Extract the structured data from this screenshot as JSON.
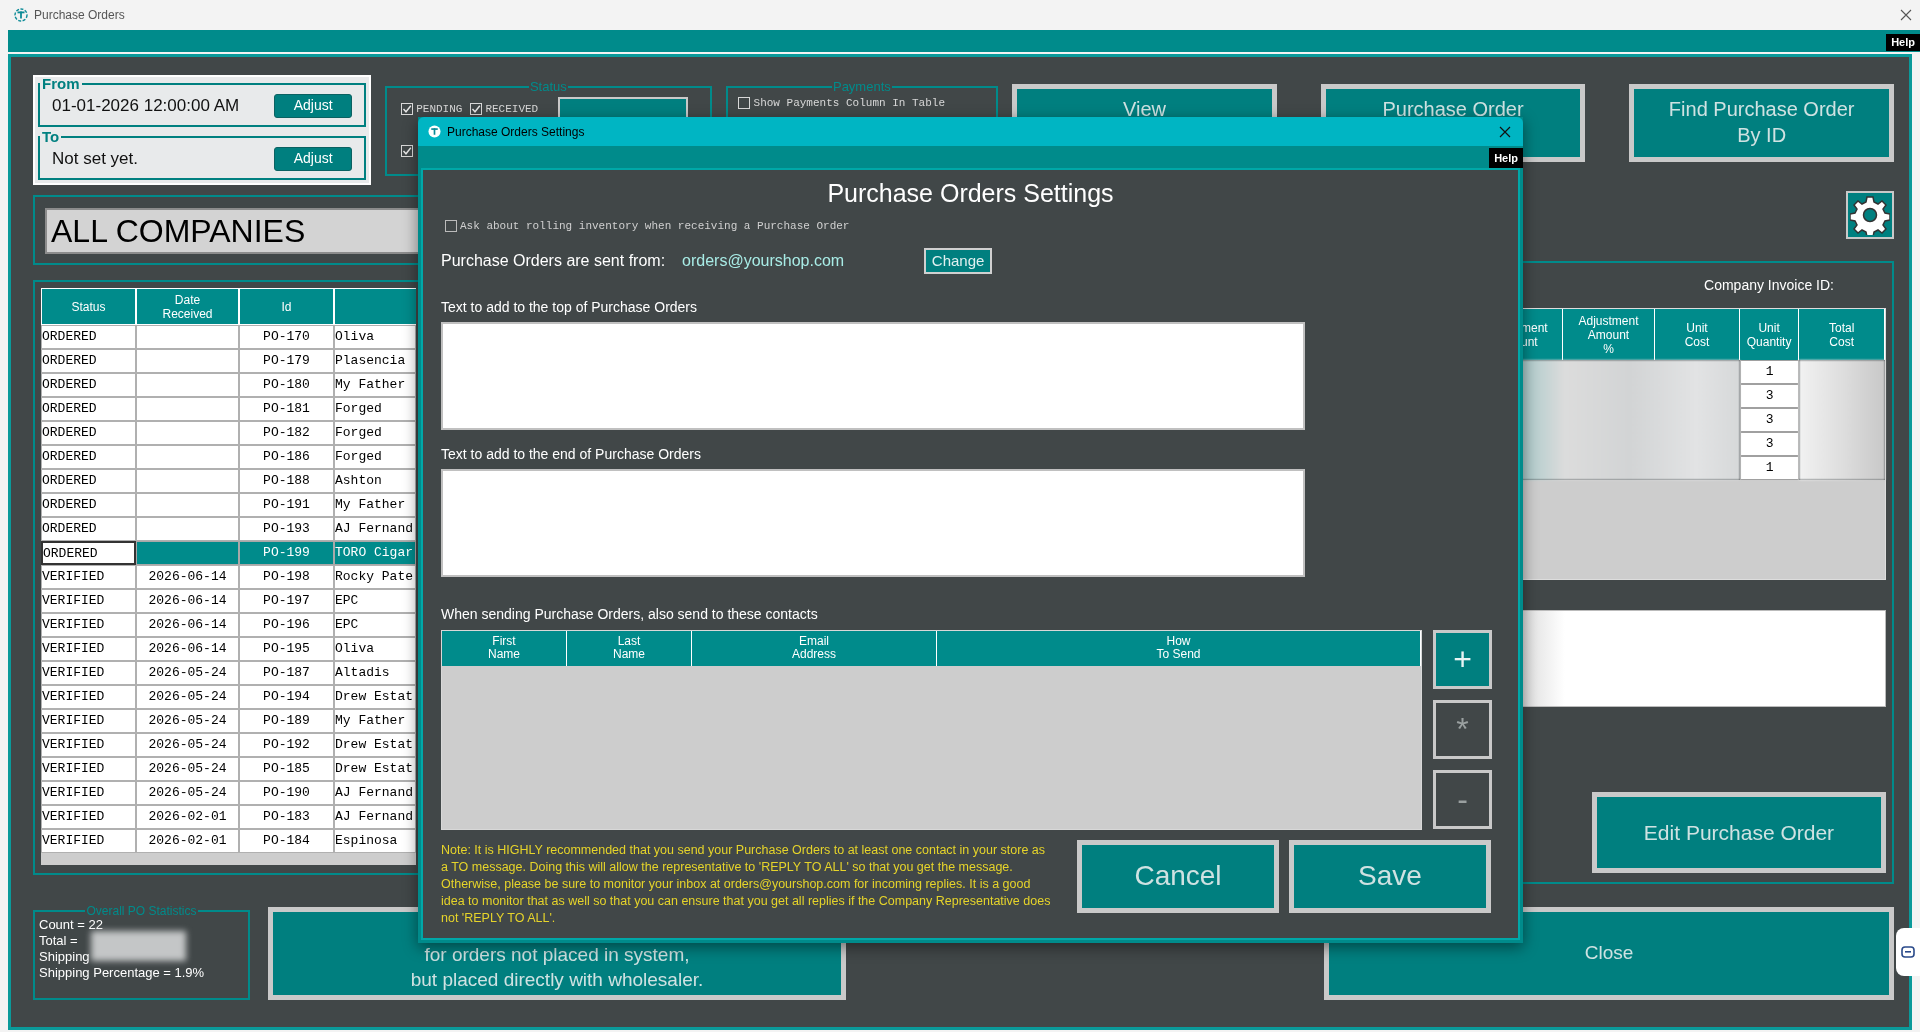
{
  "window": {
    "title": "Purchase Orders",
    "help": "Help"
  },
  "date_range": [
    {
      "label": "From",
      "value": "01-01-2026 12:00:00 AM",
      "button": "Adjust"
    },
    {
      "label": "To",
      "value": "Not set yet.",
      "button": "Adjust"
    }
  ],
  "status_filter": {
    "title": "Status",
    "options": [
      {
        "label": "PENDING",
        "checked": true
      },
      {
        "label": "RECEIVED",
        "checked": true
      },
      {
        "checked": true
      }
    ]
  },
  "payments": {
    "title": "Payments",
    "options": [
      {
        "label": "Show Payments Column In Table",
        "checked": false
      }
    ]
  },
  "top_buttons": [
    "View",
    "Purchase Order",
    "Find Purchase Order\nBy ID"
  ],
  "company_filter": {
    "value": "ALL COMPANIES"
  },
  "orders_table": {
    "columns": [
      "Status",
      "Date\nReceived",
      "Id"
    ],
    "rows": [
      {
        "status": "ORDERED",
        "id": "PO-170",
        "column_4": "Oliva",
        "selected": false
      },
      {
        "status": "ORDERED",
        "id": "PO-179",
        "column_4": "Plasencia",
        "selected": false
      },
      {
        "status": "ORDERED",
        "id": "PO-180",
        "column_4": "My Father",
        "selected": false
      },
      {
        "status": "ORDERED",
        "id": "PO-181",
        "column_4": "Forged",
        "selected": false
      },
      {
        "status": "ORDERED",
        "id": "PO-182",
        "column_4": "Forged",
        "selected": false
      },
      {
        "status": "ORDERED",
        "id": "PO-186",
        "column_4": "Forged",
        "selected": false
      },
      {
        "status": "ORDERED",
        "id": "PO-188",
        "column_4": "Ashton",
        "selected": false
      },
      {
        "status": "ORDERED",
        "id": "PO-191",
        "column_4": "My Father",
        "selected": false
      },
      {
        "status": "ORDERED",
        "id": "PO-193",
        "column_4": "AJ Fernand",
        "selected": false
      },
      {
        "status": "ORDERED",
        "id": "PO-199",
        "column_4": "TORO Cigar",
        "selected": true
      },
      {
        "status": "VERIFIED",
        "date_received": "2026-06-14",
        "id": "PO-198",
        "column_4": "Rocky Pate",
        "selected": false
      },
      {
        "status": "VERIFIED",
        "date_received": "2026-06-14",
        "id": "PO-197",
        "column_4": "EPC",
        "selected": false
      },
      {
        "status": "VERIFIED",
        "date_received": "2026-06-14",
        "id": "PO-196",
        "column_4": "EPC",
        "selected": false
      },
      {
        "status": "VERIFIED",
        "date_received": "2026-06-14",
        "id": "PO-195",
        "column_4": "Oliva",
        "selected": false
      },
      {
        "status": "VERIFIED",
        "date_received": "2026-05-24",
        "id": "PO-187",
        "column_4": "Altadis",
        "selected": false
      },
      {
        "status": "VERIFIED",
        "date_received": "2026-05-24",
        "id": "PO-194",
        "column_4": "Drew Estat",
        "selected": false
      },
      {
        "status": "VERIFIED",
        "date_received": "2026-05-24",
        "id": "PO-189",
        "column_4": "My Father",
        "selected": false
      },
      {
        "status": "VERIFIED",
        "date_received": "2026-05-24",
        "id": "PO-192",
        "column_4": "Drew Estat",
        "selected": false
      },
      {
        "status": "VERIFIED",
        "date_received": "2026-05-24",
        "id": "PO-185",
        "column_4": "Drew Estat",
        "selected": false
      },
      {
        "status": "VERIFIED",
        "date_received": "2026-05-24",
        "id": "PO-190",
        "column_4": "AJ Fernand",
        "selected": false
      },
      {
        "status": "VERIFIED",
        "date_received": "2026-02-01",
        "id": "PO-183",
        "column_4": "AJ Fernand",
        "selected": false
      },
      {
        "status": "VERIFIED",
        "date_received": "2026-02-01",
        "id": "PO-184",
        "column_4": "Espinosa",
        "selected": false
      }
    ]
  },
  "invoice_panel": {
    "label": "Company Invoice ID:",
    "columns": [
      "ment\nunt",
      "Adjustment\nAmount\n%",
      "Unit\nCost",
      "Unit\nQuantity",
      "Total\nCost"
    ],
    "unit_quantities": [
      "1",
      "3",
      "3",
      "3",
      "1"
    ],
    "edit_button": "Edit Purchase Order"
  },
  "statistics": {
    "title": "Overall PO Statistics",
    "lines": [
      "Count = 22",
      "Total =",
      "Shipping",
      "Shipping Percentage = 1.9%"
    ]
  },
  "bottom_buttons": [
    "for orders not placed in system,\nbut placed directly with wholesaler.",
    "Close"
  ],
  "settings_dialog": {
    "title": "Purchase Orders Settings",
    "help": "Help",
    "heading": "Purchase Orders Settings",
    "rolling_inventory": {
      "label": "Ask about rolling inventory when receiving a Purchase Order",
      "checked": false
    },
    "sent_from": {
      "label": "Purchase Orders are sent from:",
      "value": "orders@yourshop.com",
      "button": "Change"
    },
    "top_text_label": "Text to add to the top of Purchase Orders",
    "end_text_label": "Text to add to the end of Purchase Orders",
    "contacts": {
      "label": "When sending Purchase Orders, also send to these contacts",
      "columns": [
        "First\nName",
        "Last\nName",
        "Email\nAddress",
        "How\nTo Send"
      ]
    },
    "side_buttons": [
      {
        "label": "+",
        "kind": "add"
      },
      {
        "label": "*",
        "kind": "edit"
      },
      {
        "label": "-",
        "kind": "remove"
      }
    ],
    "note": "Note: It is HIGHLY recommended that you send your Purchase Orders to at least one contact in your store as a TO message. Doing this will allow the representative to 'REPLY TO ALL' so that you get the message. Otherwise, please be sure to monitor your inbox at orders@yourshop.com for incoming replies. It is a good idea to monitor that as well so that you can ensure that you get all replies if the Company Representative does not 'REPLY TO ALL'.",
    "buttons": [
      "Cancel",
      "Save"
    ]
  }
}
